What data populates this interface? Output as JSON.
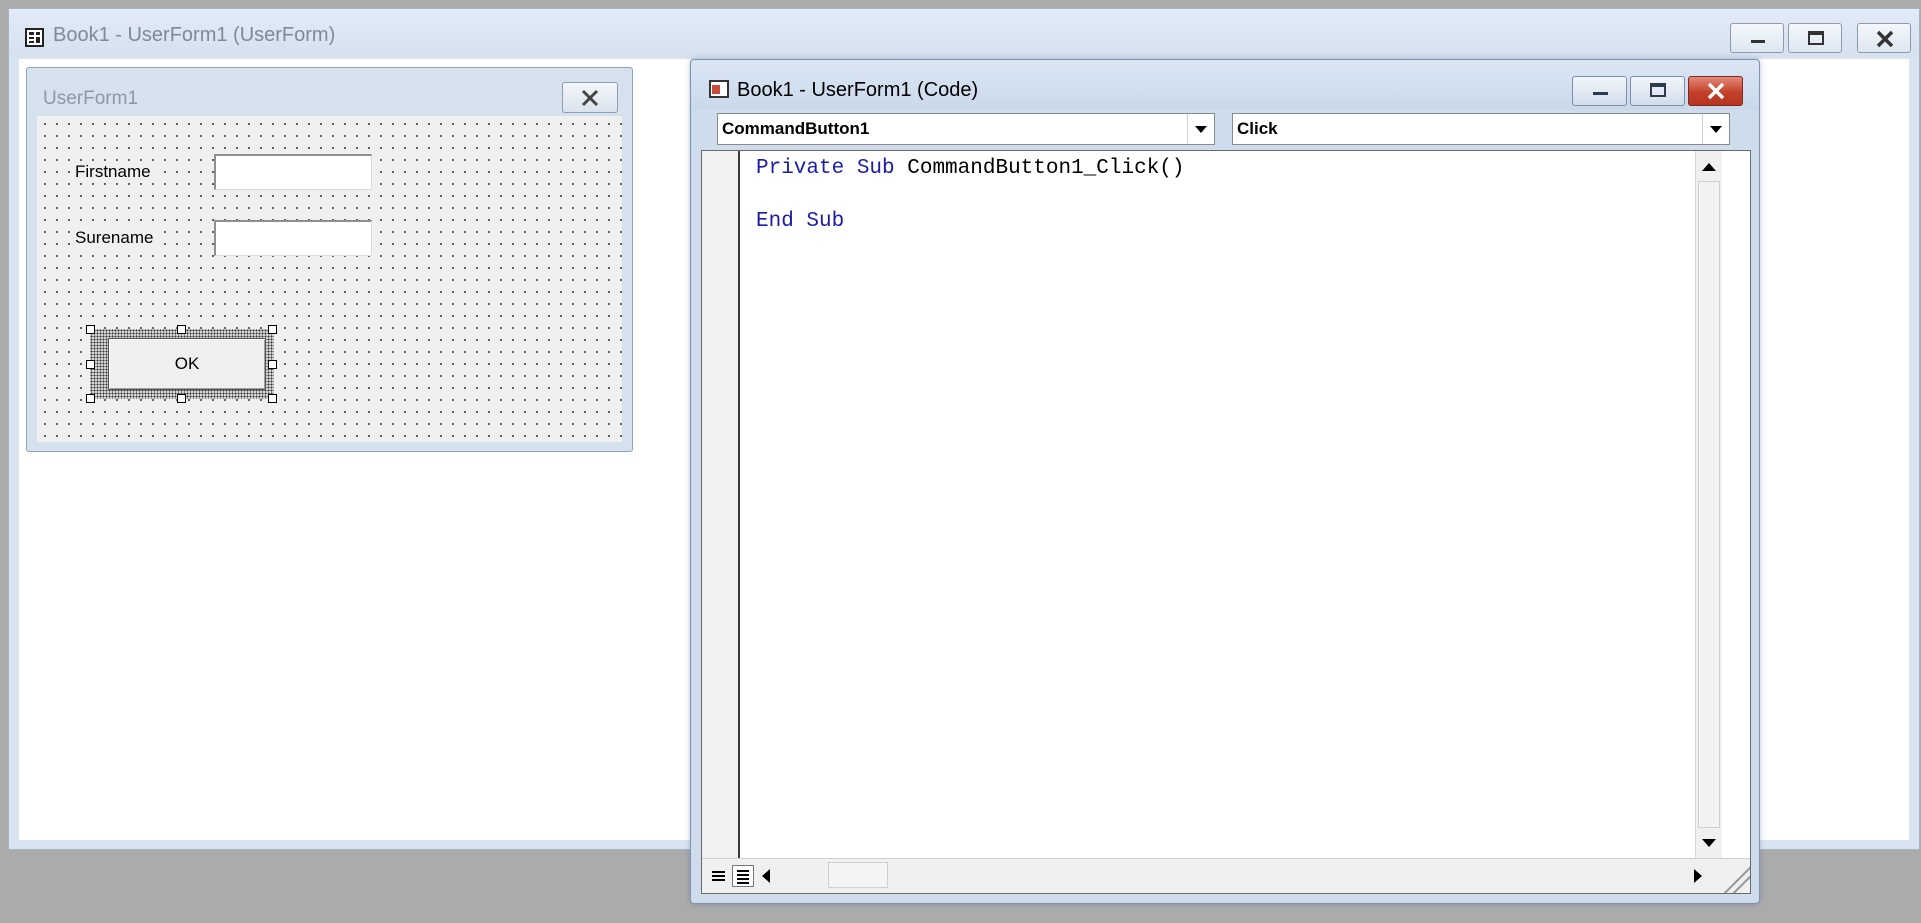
{
  "outer_window": {
    "title": "Book1 - UserForm1 (UserForm)",
    "icon": "userform-icon",
    "buttons": [
      "minimize-icon",
      "maximize-icon",
      "close-icon"
    ]
  },
  "userform": {
    "title": "UserForm1",
    "close_icon": "close-icon",
    "labels": {
      "firstname": "Firstname",
      "surename": "Surename"
    },
    "fields": {
      "firstname_value": "",
      "surename_value": ""
    },
    "ok_button_label": "OK"
  },
  "code_window": {
    "title": "Book1 - UserForm1 (Code)",
    "icon": "code-window-icon",
    "buttons": [
      "minimize-icon",
      "maximize-icon",
      "close-icon"
    ],
    "object_combo": "CommandButton1",
    "procedure_combo": "Click",
    "code_lines": [
      {
        "keyword1": "Private",
        "keyword2": "Sub",
        "rest": "CommandButton1_Click()"
      },
      {
        "keyword1": "End",
        "keyword2": "Sub",
        "rest": ""
      }
    ],
    "colors": {
      "keyword": "#1c1ca6",
      "close_button": "#c3402b"
    }
  }
}
